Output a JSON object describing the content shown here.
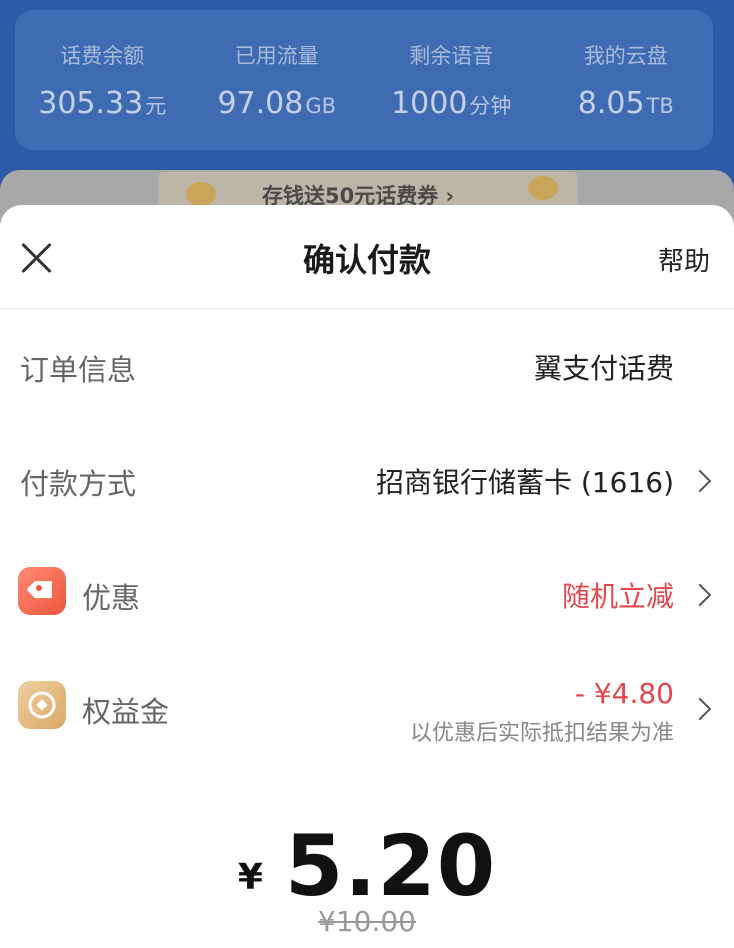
{
  "stats": [
    {
      "label": "话费余额",
      "value": "305.33",
      "unit": "元"
    },
    {
      "label": "已用流量",
      "value": "97.08",
      "unit": "GB"
    },
    {
      "label": "剩余语音",
      "value": "1000",
      "unit": "分钟"
    },
    {
      "label": "我的云盘",
      "value": "8.05",
      "unit": "TB"
    }
  ],
  "promo": {
    "text": "存钱送50元话费券 ›"
  },
  "sheet": {
    "title": "确认付款",
    "help": "帮助",
    "order_label": "订单信息",
    "order_value": "翼支付话费",
    "payment_label": "付款方式",
    "payment_value": "招商银行储蓄卡 (1616)",
    "discount_label": "优惠",
    "discount_value": "随机立减",
    "benefit_label": "权益金",
    "benefit_value": "- ¥4.80",
    "benefit_note": "以优惠后实际抵扣结果为准",
    "currency": "¥",
    "amount": "5.20",
    "original_price": "¥10.00"
  },
  "colors": {
    "accent_red": "#e8464e",
    "header_blue": "#2c5aa6"
  },
  "icons": {
    "close": "close-icon",
    "discount": "tag-icon",
    "benefit": "coin-icon",
    "chevron": "chevron-right-icon"
  }
}
